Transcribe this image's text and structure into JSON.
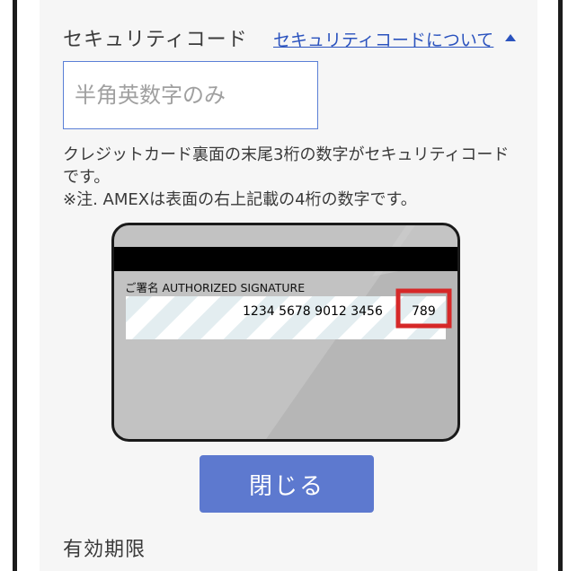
{
  "security_code": {
    "label": "セキュリティコード",
    "help_link": "セキュリティコードについて",
    "input": {
      "value": "",
      "placeholder": "半角英数字のみ"
    },
    "description_line1": "クレジットカード裏面の末尾3桁の数字がセキュリティコードです。",
    "description_line2": "※注. AMEXは表面の右上記載の4桁の数字です。"
  },
  "card_illustration": {
    "signature_label": "ご署名 AUTHORIZED SIGNATURE",
    "card_number": "1234  5678  9012  3456",
    "security_digits": "789",
    "highlight_color": "#d62828"
  },
  "buttons": {
    "close_label": "閉じる"
  },
  "expiry": {
    "label": "有効期限"
  }
}
